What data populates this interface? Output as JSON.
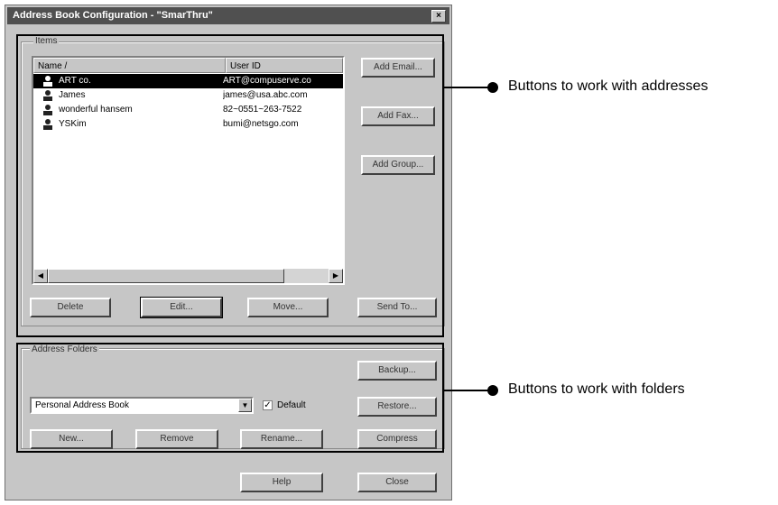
{
  "window": {
    "title": "Address Book Configuration - \"SmarThru\"",
    "close_glyph": "×"
  },
  "items_group": {
    "label": "Items",
    "columns": [
      "Name /",
      "User ID"
    ],
    "rows": [
      {
        "name": "ART co.",
        "user_id": "ART@compuserve.co",
        "selected": true
      },
      {
        "name": "James",
        "user_id": "james@usa.abc.com",
        "selected": false
      },
      {
        "name": "wonderful hansem",
        "user_id": "82~0551~263-7522",
        "selected": false
      },
      {
        "name": "YSKim",
        "user_id": "bumi@netsgo.com",
        "selected": false
      }
    ],
    "side_buttons": {
      "add_email": "Add Email...",
      "add_fax": "Add Fax...",
      "add_group": "Add Group..."
    },
    "bottom_buttons": {
      "delete": "Delete",
      "edit": "Edit...",
      "move": "Move...",
      "send_to": "Send To..."
    }
  },
  "folders_group": {
    "label": "Address Folders",
    "folder_value": "Personal Address Book",
    "default_label": "Default",
    "default_checked": "✓",
    "buttons": {
      "backup": "Backup...",
      "restore": "Restore...",
      "new": "New...",
      "remove": "Remove",
      "rename": "Rename...",
      "compress": "Compress"
    }
  },
  "footer": {
    "help": "Help",
    "close": "Close"
  },
  "callouts": {
    "addresses": "Buttons to work with addresses",
    "folders": "Buttons to work with folders"
  }
}
